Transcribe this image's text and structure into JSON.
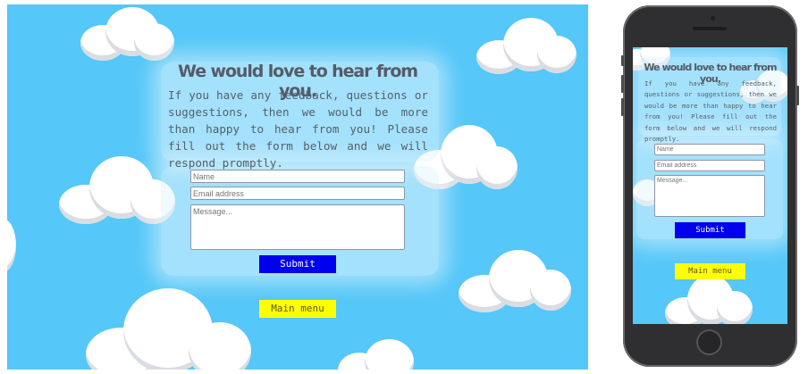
{
  "desktop": {
    "heading": "We would love to hear from you.",
    "intro": "If you have any feedback, questions or suggestions, then we would be more than happy to hear from you! Please fill out the form below and we will respond promptly.",
    "form": {
      "name_placeholder": "Name",
      "email_placeholder": "Email address",
      "message_placeholder": "Message...",
      "submit_label": "Submit"
    },
    "main_menu_label": "Main menu"
  },
  "mobile": {
    "heading": "We would love to hear from you.",
    "intro": "If you have any feedback, questions or suggestions, then we would be more than happy to hear from you! Please fill out the form below and we will respond promptly.",
    "form": {
      "name_placeholder": "Name",
      "email_placeholder": "Email address",
      "message_placeholder": "Message...",
      "submit_label": "Submit"
    },
    "main_menu_label": "Main menu"
  },
  "colors": {
    "sky": "#55c7f8",
    "submit_button": "#0000ee",
    "main_menu_button": "#ffff00",
    "heading_text": "#555b66"
  },
  "icons": [
    "cloud-icon",
    "camera-icon",
    "speaker-icon",
    "home-button-icon"
  ]
}
